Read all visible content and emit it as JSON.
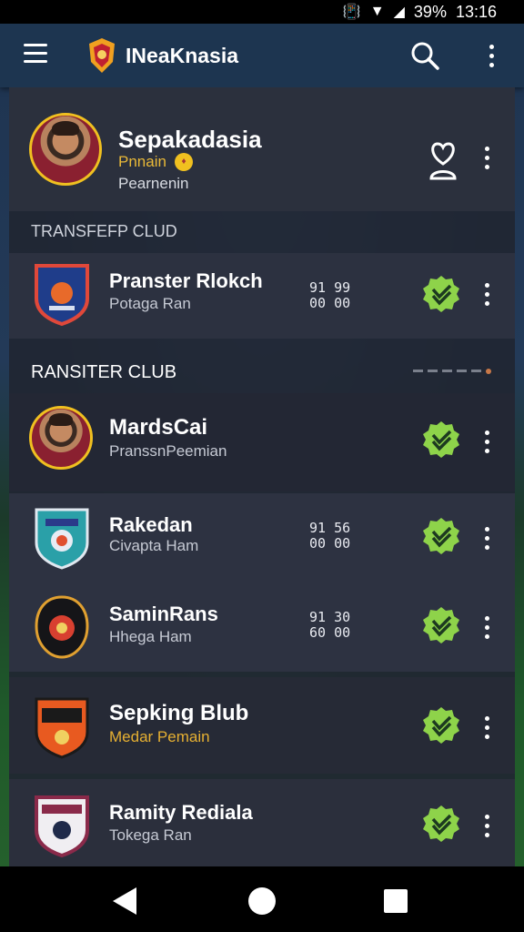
{
  "status_bar": {
    "battery": "39%",
    "time": "13:16"
  },
  "app_bar": {
    "title": "INeaKnasia"
  },
  "profile": {
    "name": "Sepakadasia",
    "role": "Pnnain",
    "subtitle": "Pearnenin"
  },
  "sections": {
    "first": "TRANSFEFP CLUD",
    "second": "RANSITER CLUB"
  },
  "items": [
    {
      "name": "Pranster Rlokch",
      "sub": "Potaga Ran",
      "stats": [
        "91  99",
        "00  00"
      ]
    },
    {
      "name": "MardsCai",
      "sub": "PranssnPeemian"
    },
    {
      "name": "Rakedan",
      "sub": "Civapta Ham",
      "stats": [
        "91  56",
        "00  00"
      ]
    },
    {
      "name": "SaminRans",
      "sub": "Hhega Ham",
      "stats": [
        "91  30",
        "60  00"
      ]
    },
    {
      "name": "Sepking Blub",
      "sub": "Medar Pemain"
    },
    {
      "name": "Ramity Rediala",
      "sub": "Tokega Ran"
    }
  ],
  "colors": {
    "accent_check": "#8ed34a",
    "gold": "#f0c020"
  }
}
